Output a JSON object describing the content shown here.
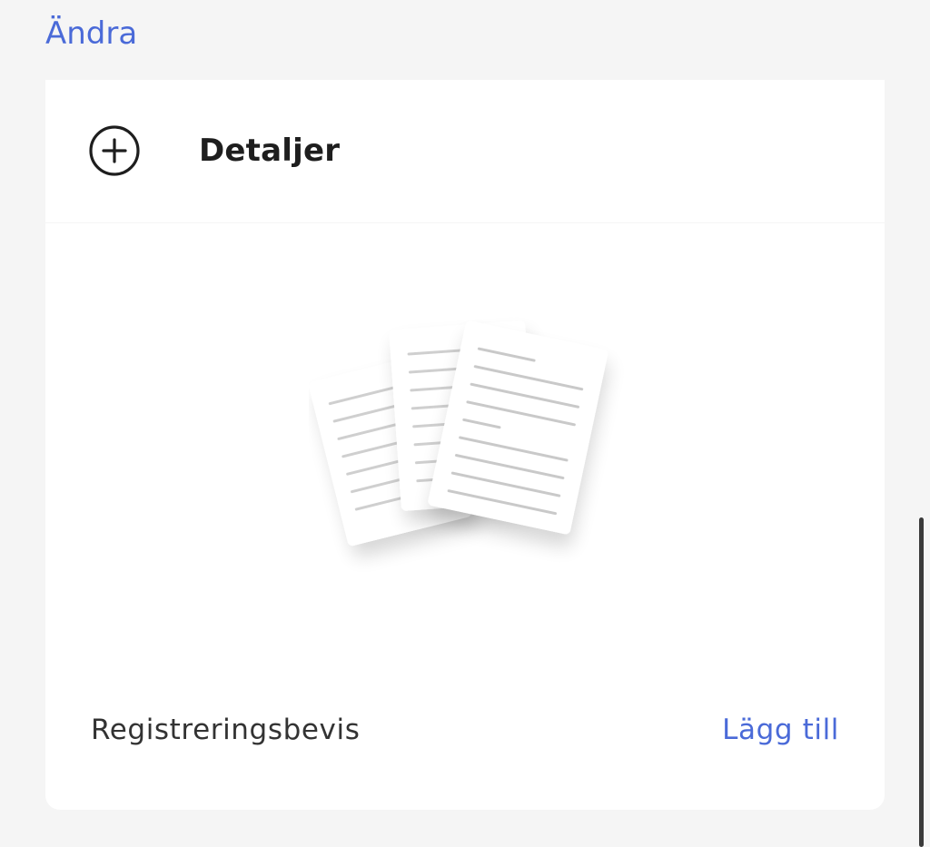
{
  "header": {
    "edit_label": "Ändra"
  },
  "details": {
    "label": "Detaljer",
    "icon": "plus-circle-icon"
  },
  "document": {
    "title": "Registreringsbevis",
    "add_label": "Lägg till",
    "illustration_icon": "documents-stack-icon"
  },
  "colors": {
    "accent": "#4a6ad8",
    "background": "#f5f5f5",
    "card": "#ffffff",
    "text": "#1e1e1e"
  }
}
